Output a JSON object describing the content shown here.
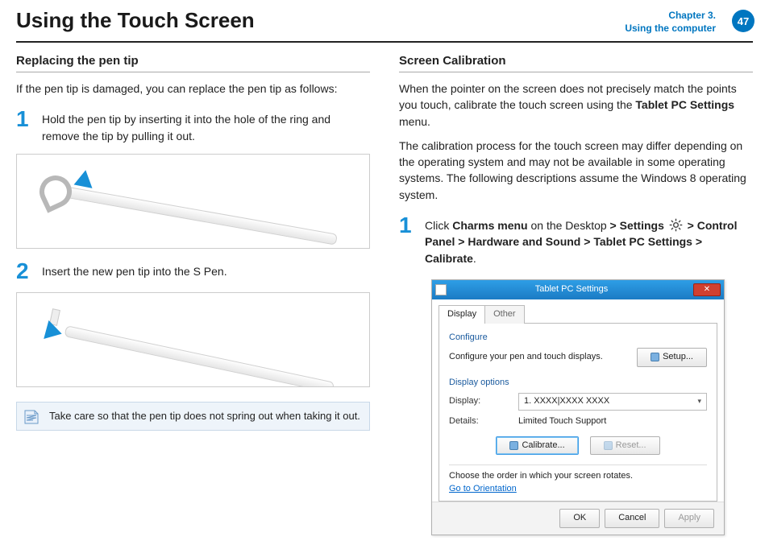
{
  "header": {
    "title": "Using the Touch Screen",
    "chapter_line1": "Chapter 3.",
    "chapter_line2": "Using the computer",
    "page": "47"
  },
  "left": {
    "heading": "Replacing the pen tip",
    "intro": "If the pen tip is damaged, you can replace the pen tip as follows:",
    "step1_num": "1",
    "step1": "Hold the pen tip by inserting it into the hole of the ring and remove the tip by pulling it out.",
    "step2_num": "2",
    "step2": "Insert the new pen tip into the S Pen.",
    "note": "Take care so that the pen tip does not spring out when taking it out."
  },
  "right": {
    "heading": "Screen Calibration",
    "p1a": "When the pointer on the screen does not precisely match the points you touch, calibrate the touch screen using the ",
    "p1b": "Tablet PC Settings",
    "p1c": " menu.",
    "p2": "The calibration process for the touch screen may differ depending on the operating system and may not be available in some operating systems. The following descriptions assume the Windows 8 operating system.",
    "step1_num": "1",
    "step1_a": "Click ",
    "step1_b": "Charms menu",
    "step1_c": " on the Desktop ",
    "step1_d": "> ",
    "step1_e": "Settings",
    "step1_f": " > ",
    "step1_g": "Control Panel",
    "step1_h": " > ",
    "step1_i": "Hardware and Sound",
    "step1_j": " > ",
    "step1_k": "Tablet PC Settings",
    "step1_l": " > ",
    "step1_m": "Calibrate",
    "step1_n": "."
  },
  "dialog": {
    "title": "Tablet PC Settings",
    "tab_display": "Display",
    "tab_other": "Other",
    "grp_configure": "Configure",
    "configure_text": "Configure your pen and touch displays.",
    "btn_setup": "Setup...",
    "grp_display_options": "Display options",
    "lbl_display": "Display:",
    "dropdown_value": "1. XXXX|XXXX XXXX",
    "lbl_details": "Details:",
    "details_value": "Limited Touch Support",
    "btn_calibrate": "Calibrate...",
    "btn_reset": "Reset...",
    "orient_text": "Choose the order in which your screen rotates.",
    "orient_link": "Go to Orientation",
    "btn_ok": "OK",
    "btn_cancel": "Cancel",
    "btn_apply": "Apply"
  }
}
